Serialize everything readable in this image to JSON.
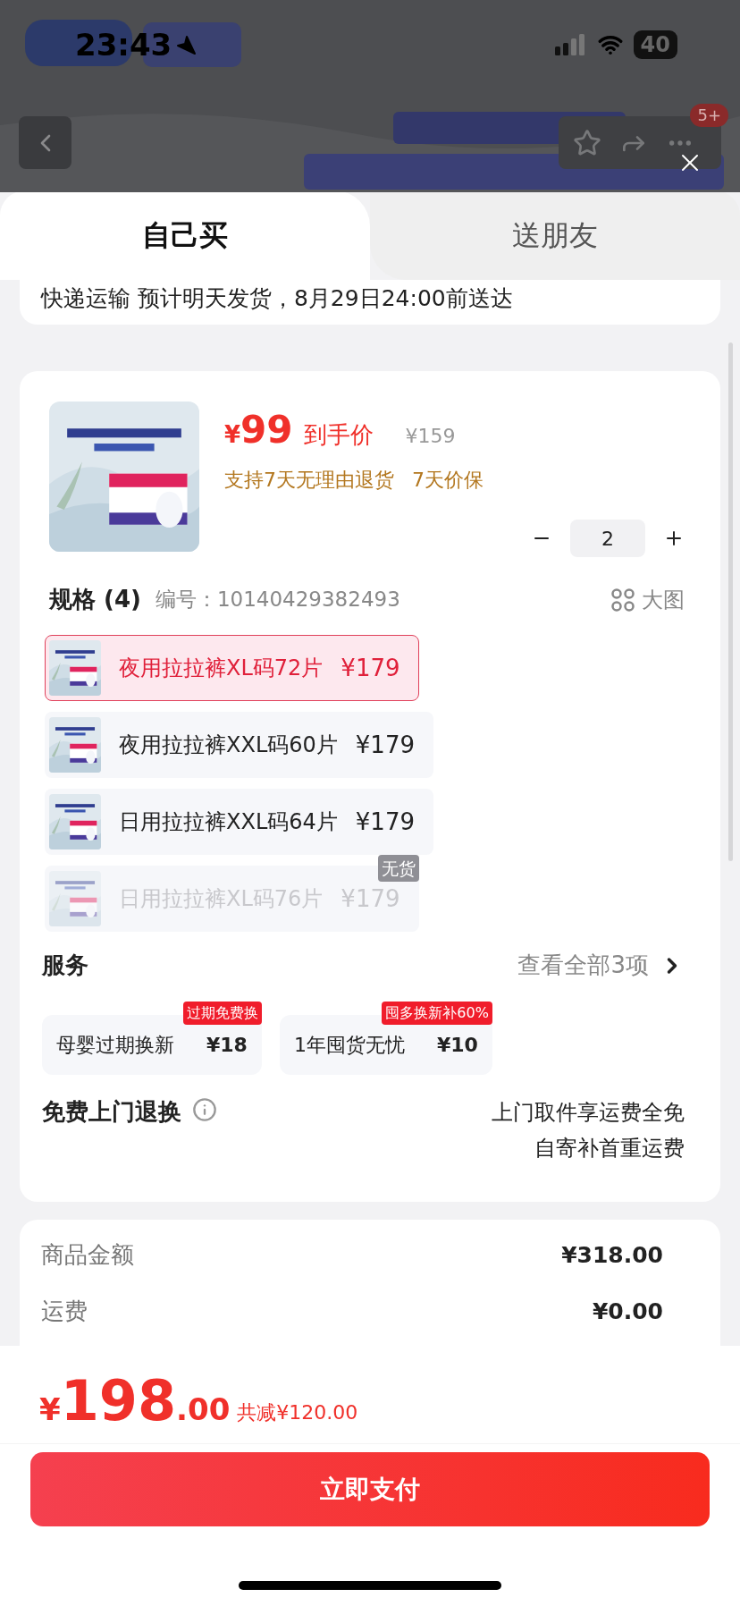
{
  "status_bar": {
    "time": "23:43",
    "battery": "40"
  },
  "header": {
    "badge": "5+"
  },
  "tabs": [
    {
      "label": "自己买",
      "selected": true
    },
    {
      "label": "送朋友",
      "selected": false
    }
  ],
  "delivery": {
    "text": "快递运输 预计明天发货，8月29日24:00前送达"
  },
  "product": {
    "currency": "¥",
    "price": "99",
    "price_label": "到手价",
    "original_price": "¥159",
    "guarantees": [
      "支持7天无理由退货",
      "7天价保"
    ],
    "quantity": "2"
  },
  "spec": {
    "title": "规格 (4)",
    "code": "编号：10140429382493",
    "view_label": "大图",
    "options": [
      {
        "label": "夜用拉拉裤XL码72片",
        "price": "¥179",
        "selected": true,
        "available": true
      },
      {
        "label": "夜用拉拉裤XXL码60片",
        "price": "¥179",
        "selected": false,
        "available": true
      },
      {
        "label": "日用拉拉裤XXL码64片",
        "price": "¥179",
        "selected": false,
        "available": true
      },
      {
        "label": "日用拉拉裤XL码76片",
        "price": "¥179",
        "selected": false,
        "available": false,
        "badge": "无货"
      }
    ]
  },
  "services": {
    "title": "服务",
    "link": "查看全部3项",
    "items": [
      {
        "name": "母婴过期换新",
        "price": "¥18",
        "tag": "过期免费换"
      },
      {
        "name": "1年囤货无忧",
        "price": "¥10",
        "tag": "囤多换新补60%"
      }
    ]
  },
  "free_return": {
    "title": "免费上门退换",
    "lines": [
      "上门取件享运费全免",
      "自寄补首重运费"
    ]
  },
  "summary": {
    "rows": [
      {
        "label": "商品金额",
        "value": "¥318.00"
      },
      {
        "label": "运费",
        "value": "¥0.00"
      }
    ]
  },
  "footer": {
    "currency": "¥",
    "total_int": "198",
    "total_dec": ".00",
    "saving": "共减¥120.00",
    "pay_button": "立即支付"
  }
}
